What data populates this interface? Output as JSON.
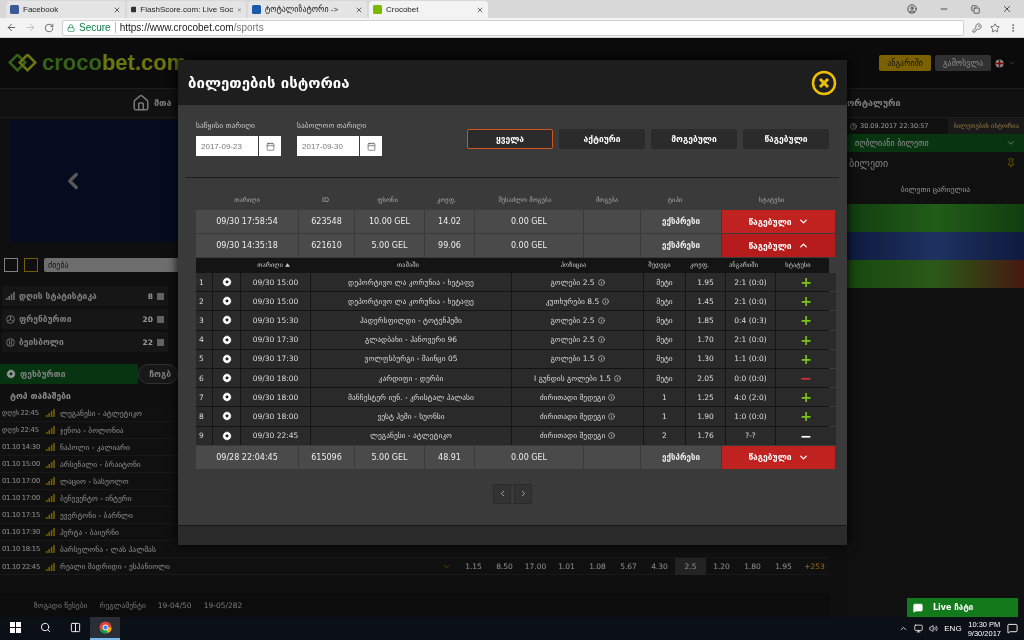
{
  "browser": {
    "tabs": [
      {
        "title": "Facebook",
        "kind": "facebook",
        "selected": false
      },
      {
        "title": "FlashScore.com: Live Soc",
        "kind": "flashscore",
        "selected": false
      },
      {
        "title": "ტოტალიზატორი ->",
        "kind": "totalizator",
        "selected": false
      },
      {
        "title": "Crocobet",
        "kind": "crocobet",
        "selected": true
      }
    ],
    "secure": "Secure",
    "url": "https://www.crocobet.com",
    "url_path": "/sports"
  },
  "site": {
    "logo_left": "croco",
    "logo_right": "bet.com",
    "header_buttons": [
      {
        "label": "ანგარიში",
        "kind": "primary"
      },
      {
        "label": "გამოსვლა",
        "kind": "secondary"
      }
    ],
    "nav_left": "მთა",
    "nav_right": "ორტალური",
    "search": {
      "placeholder": "ძიება"
    },
    "sports": [
      {
        "name": "დღის სტატისტიკა",
        "count": "8",
        "kind": "stats"
      },
      {
        "name": "ფრენბურთი",
        "count": "20",
        "kind": "volleyball"
      },
      {
        "name": "ბეისბოლი",
        "count": "22",
        "kind": "baseball"
      }
    ],
    "sport_tabs": [
      {
        "label": "ფეხბურთი",
        "selected": true
      },
      {
        "label": "ჩოგბ",
        "selected": false
      }
    ],
    "top_games_title": "ტოპ თამაშები",
    "matches": [
      {
        "time": "დღეს 22:45",
        "teams": "ლეგანესი - ატლეტიკო"
      },
      {
        "time": "დღეს 22:45",
        "teams": "ჯენოა - ბოლონია"
      },
      {
        "time": "01.10 14:30",
        "teams": "ნაპოლი - კალიარი"
      },
      {
        "time": "01.10 15:00",
        "teams": "არსენალი - ბრაიტონი"
      },
      {
        "time": "01.10 17:00",
        "teams": "ლაციო - სასუოლო"
      },
      {
        "time": "01.10 17:00",
        "teams": "ბენევენტო - ინტერი"
      },
      {
        "time": "01.10 17:15",
        "teams": "ევერტონი - ბარნლი"
      },
      {
        "time": "01.10 17:30",
        "teams": "ჰერტა - ბაიერნი"
      },
      {
        "time": "01.10 18:15",
        "teams": "ბარსელონა - ლას პალმას"
      },
      {
        "time": "01.10 22:45",
        "teams": "რეალი მადრიდი - ესპანიოლი",
        "odds": [
          {
            "value": "1.15",
            "selected": false
          },
          {
            "value": "8.50",
            "selected": false
          },
          {
            "value": "17.00",
            "selected": false
          },
          {
            "value": "1.01",
            "selected": false
          },
          {
            "value": "1.08",
            "selected": false
          },
          {
            "value": "5.67",
            "selected": false
          },
          {
            "value": "4.30",
            "selected": false
          },
          {
            "value": "2.5",
            "selected": true
          },
          {
            "value": "1.20",
            "selected": false
          },
          {
            "value": "1.80",
            "selected": false
          },
          {
            "value": "1.95",
            "selected": false
          }
        ],
        "more": "+253"
      }
    ],
    "footer_links": [
      "ზოგადი წესები",
      "რეგლამენტი",
      "19-04/50",
      "19-05/282"
    ],
    "right_panel": {
      "clock": "30.09.2017 22:30:57",
      "history_tab": "ბილეთების ისტორია",
      "lucky_ticket": "იღბლიანი ბილეთი",
      "ticket_title": "ბილეთი",
      "ticket_empty": "ბილეთი ცარიელია",
      "banners": [
        {
          "kind": "burning"
        },
        {
          "kind": "supreme"
        },
        {
          "kind": "ultimate"
        }
      ]
    },
    "live_chat": "Live ჩატი"
  },
  "modal": {
    "title": "ბილეთების ისტორია",
    "start_label": "საწყისი თარიღი",
    "start_value": "2017-09-23",
    "end_label": "საბოლოო თარიღი",
    "end_value": "2017-09-30",
    "status_tabs": [
      {
        "label": "ყველა",
        "selected": true
      },
      {
        "label": "აქტიური",
        "selected": false
      },
      {
        "label": "მოგებული",
        "selected": false
      },
      {
        "label": "წაგებული",
        "selected": false
      }
    ],
    "columns": [
      "თარიღი",
      "ID",
      "ფსონი",
      "კოეფ.",
      "შესაძლო მოგება",
      "მოგება",
      "ტიპი",
      "სტატუსი"
    ],
    "bet_columns": [
      {
        "label": "თარიღი",
        "sorted": true
      },
      {
        "label": "თამაში",
        "sorted": false
      },
      {
        "label": "პოზიცია",
        "sorted": false
      },
      {
        "label": "შედეგი",
        "sorted": false
      },
      {
        "label": "კოეფ.",
        "sorted": false
      },
      {
        "label": "ანგარიში",
        "sorted": false
      },
      {
        "label": "სტატუსი",
        "sorted": false
      }
    ],
    "tickets": [
      {
        "date": "09/30 17:58:54",
        "id": "623548",
        "stake": "10.00 GEL",
        "odds": "14.02",
        "possible_win": "0.00 GEL",
        "type": "ექსპრესი",
        "status": "წაგებული",
        "expanded": false
      },
      {
        "date": "09/30 14:35:18",
        "id": "621610",
        "stake": "5.00 GEL",
        "odds": "99.06",
        "possible_win": "0.00 GEL",
        "type": "ექსპრესი",
        "status": "წაგებული",
        "expanded": true,
        "bets": [
          {
            "no": "1",
            "date": "09/30 15:00",
            "game": "დეპორტივო ლა კორუნია - ხეტაფე",
            "position": "გოლები 2.5",
            "result": "მეტი",
            "odds": "1.95",
            "score": "2:1 (0:0)",
            "kind": "won",
            "mark": "+"
          },
          {
            "no": "2",
            "date": "09/30 15:00",
            "game": "დეპორტივო ლა კორუნია - ხეტაფე",
            "position": "კუთხურები 8.5",
            "result": "მეტი",
            "odds": "1.45",
            "score": "2:1 (0:0)",
            "kind": "won",
            "mark": "+"
          },
          {
            "no": "3",
            "date": "09/30 15:30",
            "game": "ჰადერსფილდი - ტოტენჰემი",
            "position": "გოლები 2.5",
            "result": "მეტი",
            "odds": "1.85",
            "score": "0:4 (0:3)",
            "kind": "won",
            "mark": "+"
          },
          {
            "no": "4",
            "date": "09/30 17:30",
            "game": "გლადბახი - ჰანოვერი 96",
            "position": "გოლები 2.5",
            "result": "მეტი",
            "odds": "1.70",
            "score": "2:1 (0:0)",
            "kind": "won",
            "mark": "+"
          },
          {
            "no": "5",
            "date": "09/30 17:30",
            "game": "ვოლფსბურგი - მაინცი 05",
            "position": "გოლები 1.5",
            "result": "მეტი",
            "odds": "1.30",
            "score": "1:1 (0:0)",
            "kind": "won",
            "mark": "+"
          },
          {
            "no": "6",
            "date": "09/30 18:00",
            "game": "კარდიფი - დერბი",
            "position": "I გუნდის გოლები 1.5",
            "result": "მეტი",
            "odds": "2.05",
            "score": "0:0 (0:0)",
            "kind": "lost",
            "mark": "−"
          },
          {
            "no": "7",
            "date": "09/30 18:00",
            "game": "მანჩესტერ იუნ. - კრისტალ პალასი",
            "position": "ძირითადი შედეგი",
            "result": "1",
            "odds": "1.25",
            "score": "4:0 (2:0)",
            "kind": "won",
            "mark": "+"
          },
          {
            "no": "8",
            "date": "09/30 18:00",
            "game": "ვესტ ჰემი - სუონსი",
            "position": "ძირითადი შედეგი",
            "result": "1",
            "odds": "1.90",
            "score": "1:0 (0:0)",
            "kind": "won",
            "mark": "+"
          },
          {
            "no": "9",
            "date": "09/30 22:45",
            "game": "ლეგანესი - ატლეტიკო",
            "position": "ძირითადი შედეგი",
            "result": "2",
            "odds": "1.76",
            "score": "?-?",
            "kind": "pending",
            "mark": "−"
          }
        ]
      },
      {
        "date": "09/28 22:04:45",
        "id": "615096",
        "stake": "5.00 GEL",
        "odds": "48.91",
        "possible_win": "0.00 GEL",
        "type": "ექსპრესი",
        "status": "წაგებული",
        "expanded": false
      }
    ]
  },
  "taskbar": {
    "language": "ENG",
    "time": "10:30 PM",
    "date": "9/30/2017"
  }
}
